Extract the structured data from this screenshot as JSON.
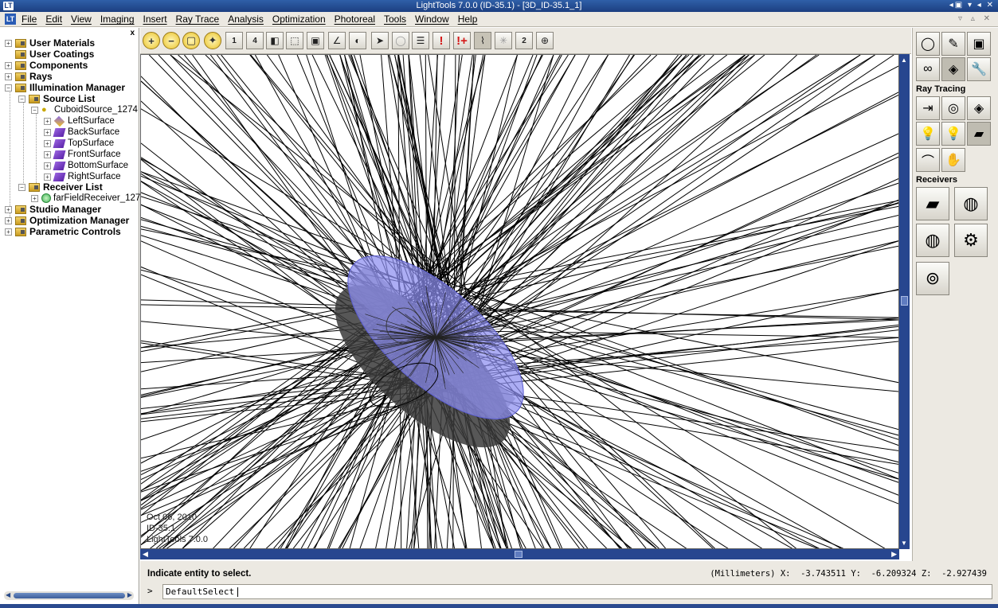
{
  "window": {
    "title": "LightTools 7.0.0  (ID-35.1) - [3D_ID-35.1_1]",
    "app_icon": "LT",
    "title_controls": "◂▣ ▾ ◂ ✕",
    "mdi_controls": "▿ ▵ ✕"
  },
  "menu": {
    "doc_icon": "LT",
    "items": [
      "File",
      "Edit",
      "View",
      "Imaging",
      "Insert",
      "Ray Trace",
      "Analysis",
      "Optimization",
      "Photoreal",
      "Tools",
      "Window",
      "Help"
    ]
  },
  "tree": {
    "close_label": "x",
    "user_materials": "User Materials",
    "user_coatings": "User Coatings",
    "components": "Components",
    "rays": "Rays",
    "illumination_manager": "Illumination Manager",
    "source_list": "Source List",
    "cuboid_source": "CuboidSource_1274",
    "surfaces": [
      "LeftSurface",
      "BackSurface",
      "TopSurface",
      "FrontSurface",
      "BottomSurface",
      "RightSurface"
    ],
    "receiver_list": "Receiver List",
    "far_field_receiver": "farFieldReceiver_127",
    "studio_manager": "Studio Manager",
    "optimization_manager": "Optimization Manager",
    "parametric_controls": "Parametric Controls",
    "expand_glyph": "+",
    "collapse_glyph": "−"
  },
  "toolbar": {
    "buttons": [
      {
        "name": "zoom-in-icon",
        "glyph": "+"
      },
      {
        "name": "zoom-out-icon",
        "glyph": "−"
      },
      {
        "name": "zoom-window-icon",
        "glyph": "▢"
      },
      {
        "name": "zoom-fit-icon",
        "glyph": "✦"
      },
      {
        "name": "single-view-icon",
        "glyph": "1"
      },
      {
        "name": "four-views-icon",
        "glyph": "4"
      },
      {
        "name": "solid-view-icon",
        "glyph": "◧"
      },
      {
        "name": "wireframe-view-icon",
        "glyph": "⬚"
      },
      {
        "name": "hidden-line-view-icon",
        "glyph": "▣"
      },
      {
        "name": "axes-icon",
        "glyph": "∠"
      },
      {
        "name": "light-icon",
        "glyph": "◐"
      },
      {
        "name": "select-arrow-icon",
        "glyph": "➤"
      },
      {
        "name": "lens-disabled-icon",
        "glyph": "◯"
      },
      {
        "name": "document-icon",
        "glyph": "☰"
      },
      {
        "name": "alert-icon",
        "glyph": "!"
      },
      {
        "name": "alert-plus-icon",
        "glyph": "!+"
      },
      {
        "name": "ray-path-icon",
        "glyph": "⌇"
      },
      {
        "name": "ray-burst-icon",
        "glyph": "✳"
      },
      {
        "name": "two-icon",
        "glyph": "2"
      },
      {
        "name": "source-ray-icon",
        "glyph": "⊕"
      }
    ]
  },
  "palette": {
    "top_buttons": [
      {
        "name": "lens-icon",
        "glyph": "◯"
      },
      {
        "name": "freeform-icon",
        "glyph": "✎"
      },
      {
        "name": "cubes-icon",
        "glyph": "▣"
      },
      {
        "name": "binoculars-icon",
        "glyph": "∞"
      },
      {
        "name": "prism-view-icon",
        "glyph": "◈"
      },
      {
        "name": "wrench-icon",
        "glyph": "🔧"
      }
    ],
    "ray_tracing_heading": "Ray Tracing",
    "ray_tracing_buttons": [
      {
        "name": "nonseq-trace-icon",
        "glyph": "⇥"
      },
      {
        "name": "seq-trace-icon",
        "glyph": "◎"
      },
      {
        "name": "trace-prism-icon",
        "glyph": "◈"
      },
      {
        "name": "bulb-icon",
        "glyph": "💡"
      },
      {
        "name": "bulb-small-icon",
        "glyph": "💡"
      },
      {
        "name": "receiver-plane-icon",
        "glyph": "▰"
      },
      {
        "name": "reflector-icon",
        "glyph": "⌒"
      },
      {
        "name": "hand-icon",
        "glyph": "✋"
      }
    ],
    "receivers_heading": "Receivers",
    "receiver_buttons": [
      {
        "name": "surface-receiver-icon",
        "glyph": "▰"
      },
      {
        "name": "farfield-receiver-icon",
        "glyph": "◍"
      },
      {
        "name": "farfield-receiver-2-icon",
        "glyph": "◍"
      },
      {
        "name": "multi-receiver-icon",
        "glyph": "⚙"
      },
      {
        "name": "ring-receiver-icon",
        "glyph": "⊚"
      }
    ]
  },
  "viewport": {
    "stamp_date": "Oct 06, 2010",
    "stamp_id": "ID-35.1",
    "stamp_version": "LightTools 7.0.0"
  },
  "command": {
    "prompt": "Indicate entity to select.",
    "coordinates": "(Millimeters) X:  -3.743511 Y:  -6.209324 Z:  -2.927439",
    "prompt_glyph": ">",
    "input_value": "DefaultSelect"
  },
  "colors": {
    "scroll": "#27468f",
    "lens_fill": "#8c8ef0",
    "lens_shadow": "#3a3a3a",
    "ray": "#000000"
  }
}
